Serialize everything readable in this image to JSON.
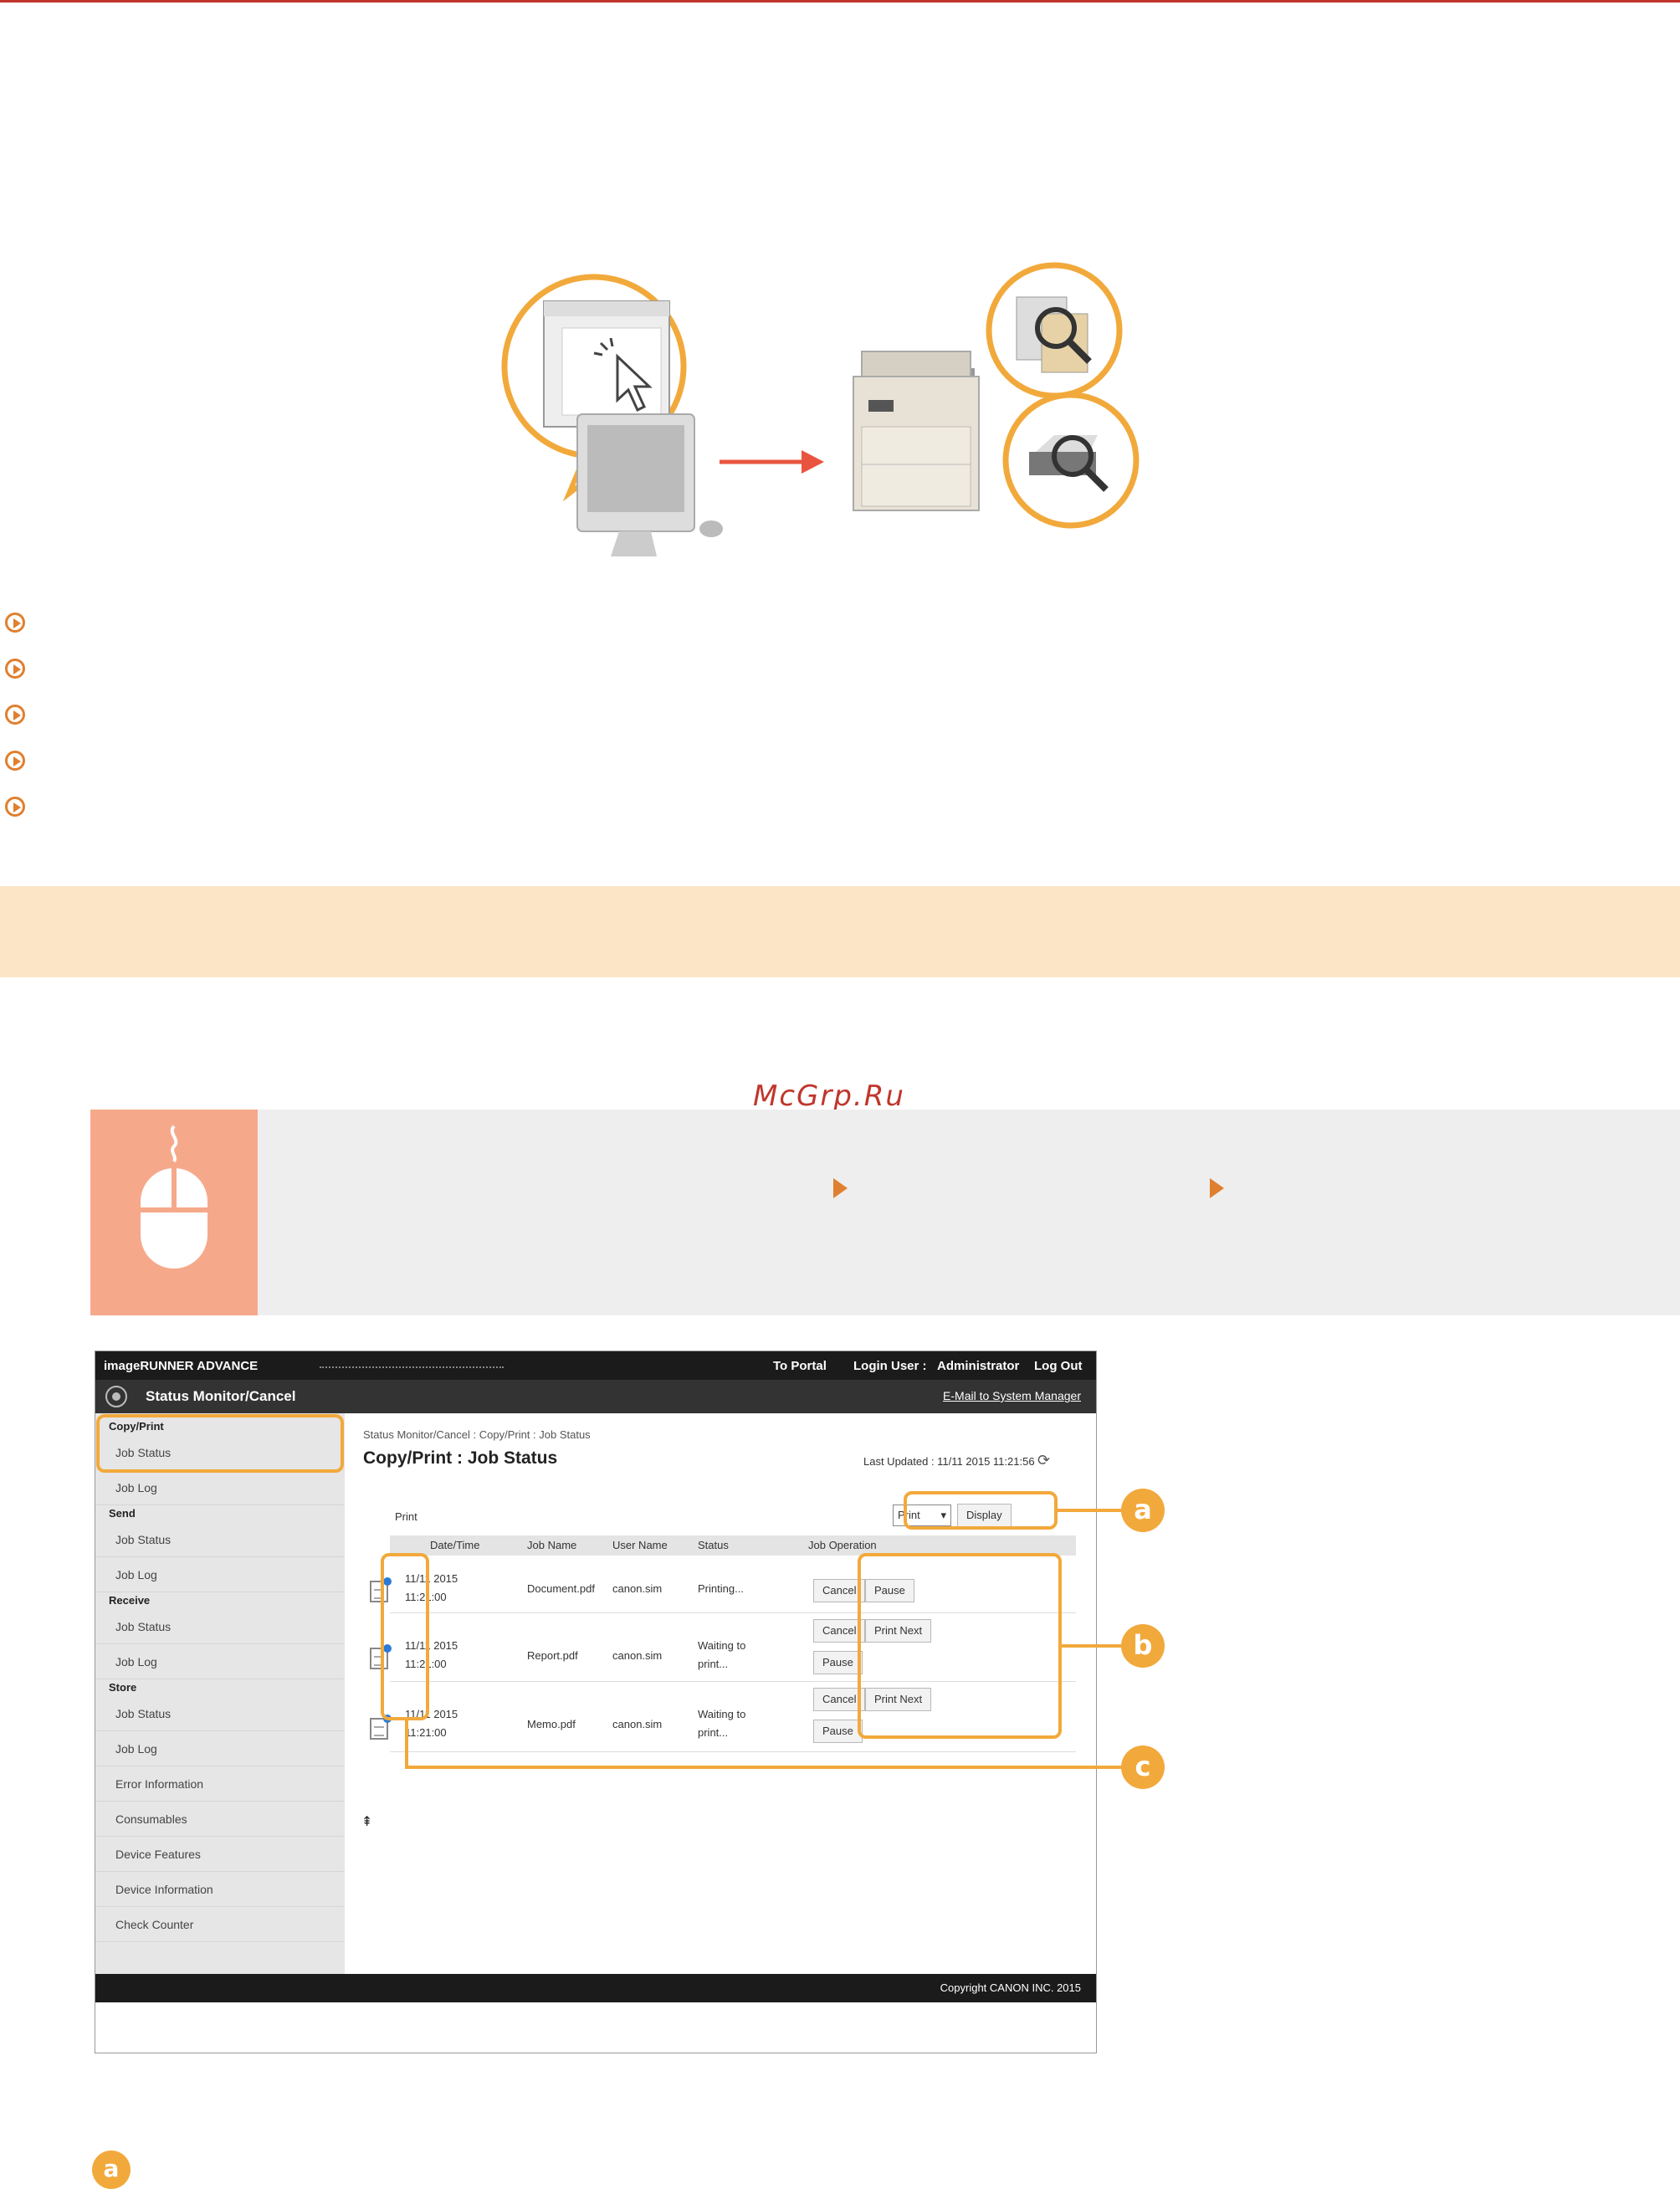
{
  "watermark": "McGrp.Ru",
  "remote_ui": {
    "product": "imageRUNNER ADVANCE",
    "top_links": {
      "portal": "To Portal",
      "login": "Login User :",
      "user": "Administrator",
      "logout": "Log Out"
    },
    "header_title": "Status Monitor/Cancel",
    "mail_link": "E-Mail to System Manager",
    "sidebar": {
      "sections": [
        {
          "label": "Copy/Print",
          "items": [
            "Job Status",
            "Job Log"
          ]
        },
        {
          "label": "Send",
          "items": [
            "Job Status",
            "Job Log"
          ]
        },
        {
          "label": "Receive",
          "items": [
            "Job Status",
            "Job Log"
          ]
        },
        {
          "label": "Store",
          "items": [
            "Job Status",
            "Job Log"
          ]
        }
      ],
      "extra_items": [
        "Error Information",
        "Consumables",
        "Device Features",
        "Device Information",
        "Check Counter"
      ]
    },
    "breadcrumb": "Status Monitor/Cancel : Copy/Print : Job Status",
    "page_title": "Copy/Print : Job Status",
    "last_updated": "Last Updated : 11/11 2015 11:21:56",
    "print_label": "Print",
    "filter_value": "Print",
    "display_button": "Display",
    "columns": [
      "Date/Time",
      "Job Name",
      "User Name",
      "Status",
      "Job Operation"
    ],
    "rows": [
      {
        "date": "11/11 2015",
        "time": "11:21:00",
        "job": "Document.pdf",
        "user": "canon.sim",
        "status_line1": "Printing...",
        "status_line2": "",
        "buttons": [
          "Cancel",
          "Pause"
        ]
      },
      {
        "date": "11/11 2015",
        "time": "11:21:00",
        "job": "Report.pdf",
        "user": "canon.sim",
        "status_line1": "Waiting to",
        "status_line2": "print...",
        "buttons": [
          "Cancel",
          "Print Next",
          "Pause"
        ]
      },
      {
        "date": "11/11 2015",
        "time": "11:21:00",
        "job": "Memo.pdf",
        "user": "canon.sim",
        "status_line1": "Waiting to",
        "status_line2": "print...",
        "buttons": [
          "Cancel",
          "Print Next",
          "Pause"
        ]
      }
    ],
    "top_mark": "⇞",
    "footer": "Copyright CANON INC. 2015"
  },
  "callouts": {
    "a": "a",
    "b": "b",
    "c": "c"
  },
  "colors": {
    "accent": "#e07f2f",
    "callout": "#f2a93b",
    "heading_bg": "#fce5c6",
    "op_icon_bg": "#f6a98a"
  }
}
